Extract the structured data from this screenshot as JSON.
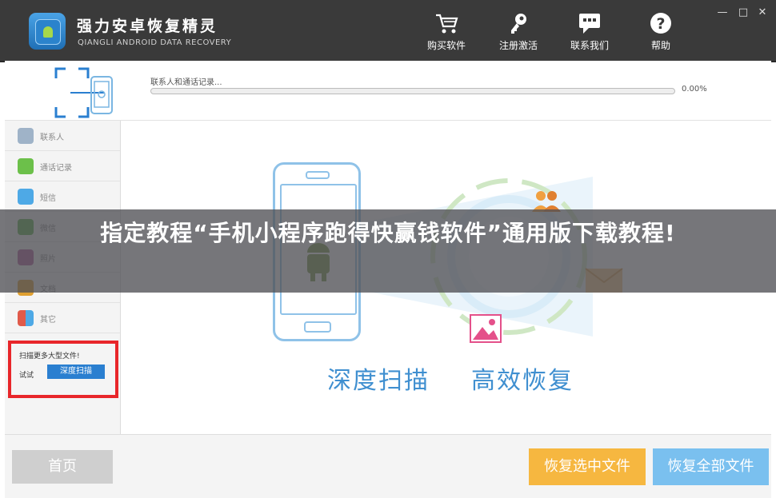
{
  "app": {
    "title": "强力安卓恢复精灵",
    "subtitle": "QIANGLI ANDROID DATA RECOVERY"
  },
  "toolbar": {
    "buy": "购买软件",
    "register": "注册激活",
    "contact": "联系我们",
    "help": "帮助"
  },
  "window_controls": {
    "minimize": "—",
    "maximize": "□",
    "close": "✕"
  },
  "scan": {
    "label": "联系人和通话记录...",
    "percent_text": "0.00%",
    "progress": 0.0
  },
  "sidebar": {
    "items": [
      {
        "label": "联系人",
        "icon": "contacts-icon",
        "color": "#9fb3c8"
      },
      {
        "label": "通话记录",
        "icon": "phone-icon",
        "color": "#6cc04a"
      },
      {
        "label": "短信",
        "icon": "sms-icon",
        "color": "#4ea9e6"
      },
      {
        "label": "微信",
        "icon": "wechat-icon",
        "color": "#5bb04a"
      },
      {
        "label": "照片",
        "icon": "photo-icon",
        "color": "#b05a9a"
      },
      {
        "label": "文档",
        "icon": "document-icon",
        "color": "#e0a030"
      },
      {
        "label": "其它",
        "icon": "other-icon",
        "color": "#e05a4a"
      }
    ],
    "promo": {
      "title": "扫描更多大型文件!",
      "try": "试试",
      "button": "深度扫描"
    }
  },
  "main": {
    "label_scan": "深度扫描",
    "label_recover": "高效恢复"
  },
  "bottom": {
    "home": "首页",
    "recover_selected": "恢复选中文件",
    "recover_all": "恢复全部文件"
  },
  "banner": {
    "text": "指定教程“手机小程序跑得快赢钱软件”通用版下载教程!"
  },
  "colors": {
    "titlebar": "#3a3a3a",
    "accent_blue": "#3f8fd0",
    "accent_orange": "#f6b740",
    "accent_lightblue": "#7ac0ef",
    "promo_border": "#e8262a"
  }
}
